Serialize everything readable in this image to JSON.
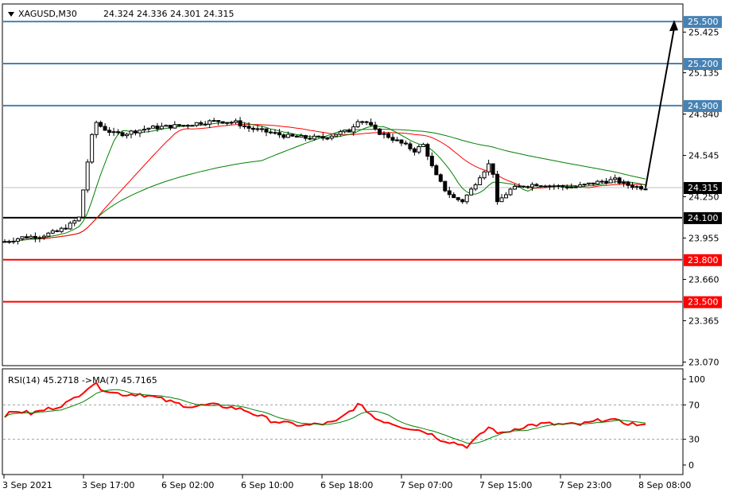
{
  "header": {
    "symbol": "XAGUSD,M30",
    "ohlc": "24.324 24.336 24.301 24.315"
  },
  "chart_data": {
    "type": "candlestick",
    "price_axis": {
      "ticks": [
        "25.425",
        "25.135",
        "24.840",
        "24.545",
        "24.250",
        "23.955",
        "23.660",
        "23.365",
        "23.070"
      ],
      "range": [
        23.05,
        25.62
      ]
    },
    "x_labels": [
      "3 Sep 2021",
      "3 Sep 17:00",
      "6 Sep 02:00",
      "6 Sep 10:00",
      "6 Sep 18:00",
      "7 Sep 07:00",
      "7 Sep 15:00",
      "7 Sep 23:00",
      "8 Sep 08:00"
    ],
    "current_price": "24.315",
    "levels": [
      {
        "label": "25.500",
        "value": 25.5,
        "color": "#4682b4"
      },
      {
        "label": "25.200",
        "value": 25.2,
        "color": "#4682b4"
      },
      {
        "label": "24.900",
        "value": 24.9,
        "color": "#4682b4"
      },
      {
        "label": "24.100",
        "value": 24.1,
        "color": "#000000"
      },
      {
        "label": "23.800",
        "value": 23.8,
        "color": "#ff0000"
      },
      {
        "label": "23.500",
        "value": 23.5,
        "color": "#ff0000"
      }
    ],
    "close_path": [
      [
        0,
        23.93
      ],
      [
        8,
        23.96
      ],
      [
        16,
        23.97
      ],
      [
        24,
        24.0
      ],
      [
        30,
        24.05
      ],
      [
        34,
        24.1
      ],
      [
        36,
        24.3
      ],
      [
        38,
        24.5
      ],
      [
        40,
        24.68
      ],
      [
        42,
        24.78
      ],
      [
        45,
        24.74
      ],
      [
        50,
        24.7
      ],
      [
        55,
        24.7
      ],
      [
        60,
        24.72
      ],
      [
        66,
        24.74
      ],
      [
        74,
        24.75
      ],
      [
        82,
        24.76
      ],
      [
        90,
        24.78
      ],
      [
        98,
        24.79
      ],
      [
        106,
        24.78
      ],
      [
        112,
        24.74
      ],
      [
        118,
        24.72
      ],
      [
        124,
        24.7
      ],
      [
        130,
        24.68
      ],
      [
        138,
        24.67
      ],
      [
        146,
        24.67
      ],
      [
        152,
        24.7
      ],
      [
        158,
        24.72
      ],
      [
        162,
        24.8
      ],
      [
        166,
        24.78
      ],
      [
        170,
        24.72
      ],
      [
        176,
        24.68
      ],
      [
        182,
        24.63
      ],
      [
        188,
        24.58
      ],
      [
        192,
        24.62
      ],
      [
        194,
        24.55
      ],
      [
        197,
        24.42
      ],
      [
        202,
        24.3
      ],
      [
        206,
        24.24
      ],
      [
        210,
        24.22
      ],
      [
        214,
        24.3
      ],
      [
        218,
        24.4
      ],
      [
        222,
        24.48
      ],
      [
        224,
        24.42
      ],
      [
        226,
        24.2
      ],
      [
        228,
        24.24
      ],
      [
        232,
        24.3
      ],
      [
        238,
        24.33
      ],
      [
        244,
        24.34
      ],
      [
        250,
        24.33
      ],
      [
        256,
        24.32
      ],
      [
        262,
        24.32
      ],
      [
        268,
        24.34
      ],
      [
        274,
        24.36
      ],
      [
        280,
        24.37
      ],
      [
        284,
        24.34
      ],
      [
        290,
        24.32
      ],
      [
        294,
        24.315
      ]
    ],
    "projection": {
      "from": 24.315,
      "to": 25.5
    },
    "indicator": {
      "label": "RSI(14) 45.2718  ->MA(7) 45.7165",
      "ticks": [
        "100",
        "70",
        "30",
        "0"
      ],
      "levels": [
        30,
        70
      ],
      "rsi": [
        [
          0,
          58
        ],
        [
          6,
          63
        ],
        [
          12,
          60
        ],
        [
          18,
          64
        ],
        [
          24,
          68
        ],
        [
          30,
          74
        ],
        [
          34,
          82
        ],
        [
          38,
          90
        ],
        [
          41,
          95
        ],
        [
          44,
          90
        ],
        [
          50,
          84
        ],
        [
          56,
          82
        ],
        [
          62,
          83
        ],
        [
          70,
          78
        ],
        [
          78,
          72
        ],
        [
          86,
          68
        ],
        [
          94,
          70
        ],
        [
          102,
          68
        ],
        [
          110,
          64
        ],
        [
          116,
          58
        ],
        [
          122,
          52
        ],
        [
          130,
          48
        ],
        [
          138,
          46
        ],
        [
          146,
          48
        ],
        [
          152,
          50
        ],
        [
          158,
          62
        ],
        [
          162,
          70
        ],
        [
          166,
          64
        ],
        [
          170,
          54
        ],
        [
          176,
          50
        ],
        [
          182,
          45
        ],
        [
          188,
          42
        ],
        [
          194,
          38
        ],
        [
          200,
          30
        ],
        [
          206,
          26
        ],
        [
          212,
          22
        ],
        [
          218,
          34
        ],
        [
          222,
          44
        ],
        [
          228,
          36
        ],
        [
          234,
          42
        ],
        [
          240,
          46
        ],
        [
          248,
          48
        ],
        [
          256,
          47
        ],
        [
          264,
          47
        ],
        [
          270,
          50
        ],
        [
          276,
          54
        ],
        [
          282,
          50
        ],
        [
          288,
          48
        ],
        [
          294,
          45.27
        ]
      ]
    }
  }
}
